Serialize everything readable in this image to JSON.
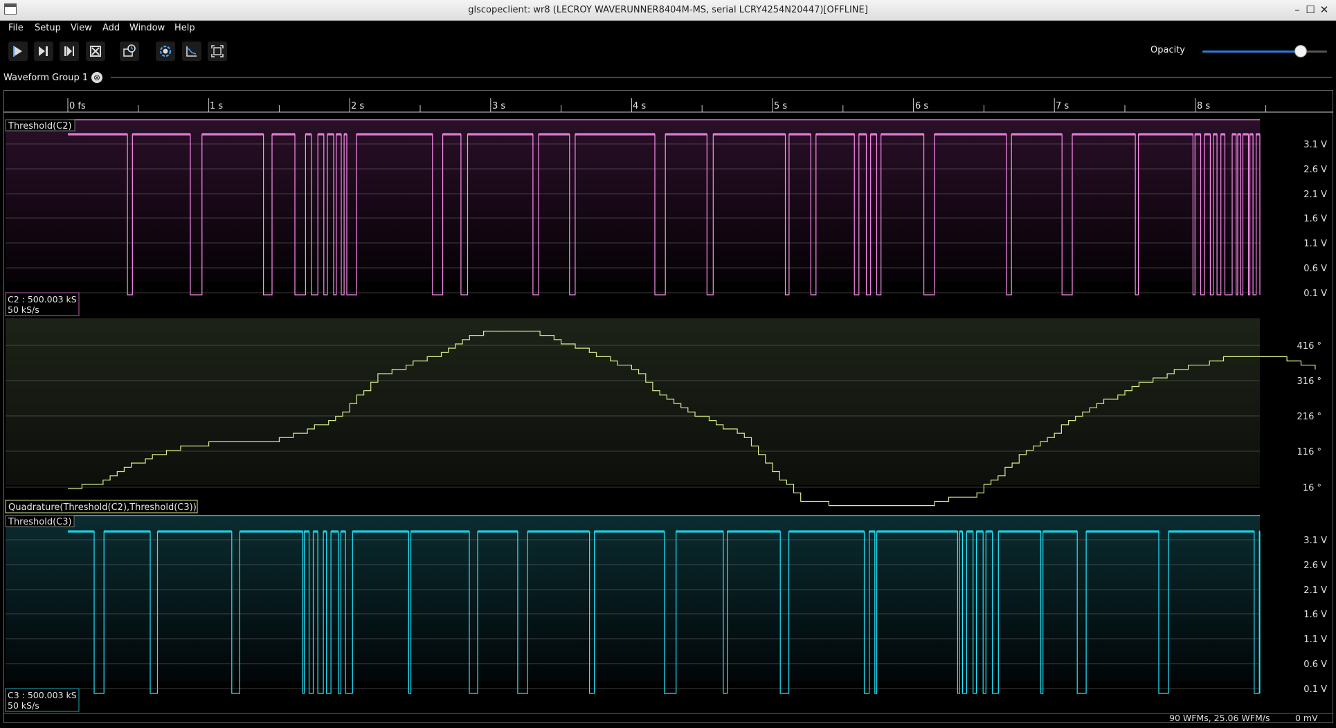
{
  "window": {
    "title": "glscopeclient: wr8 (LECROY WAVERUNNER8404M-MS, serial LCRY4254N20447)[OFFLINE]",
    "buttons": [
      "–",
      "☐",
      "✕"
    ]
  },
  "menu": [
    "File",
    "Setup",
    "View",
    "Add",
    "Window",
    "Help"
  ],
  "toolbar": {
    "buttons": [
      "start-trigger",
      "single-trigger",
      "force-trigger",
      "stop-trigger",
      "history",
      "refresh-settings",
      "graph-editor",
      "fullscreen"
    ],
    "opacity_label": "Opacity",
    "opacity_value": 0.82
  },
  "tab": {
    "label": "Waveform Group 1",
    "close": "⊗"
  },
  "timeline": {
    "ticks": [
      "0 fs",
      "1 s",
      "2 s",
      "3 s",
      "4 s",
      "5 s",
      "6 s",
      "7 s",
      "8 s"
    ]
  },
  "colors": {
    "c2": "#ff8ff0",
    "math": "#d6f08a",
    "c3": "#22e8ff",
    "grid": "#6a6a6a",
    "axis_text": "#e0e0e0"
  },
  "panels": {
    "c2": {
      "title": "Threshold(C2)",
      "info_line1": "C2 : 500.003 kS",
      "info_line2": "50 kS/s",
      "yticks": [
        "3.1 V",
        "2.6 V",
        "2.1 V",
        "1.6 V",
        "1.1 V",
        "0.6 V",
        "0.1 V"
      ]
    },
    "quad": {
      "title": "Quadrature(Threshold(C2),Threshold(C3))",
      "yticks": [
        "416 °",
        "316 °",
        "216 °",
        "116 °",
        "16 °"
      ]
    },
    "c3": {
      "title": "Threshold(C3)",
      "info_line1": "C3 : 500.003 kS",
      "info_line2": "50 kS/s",
      "yticks": [
        "3.1 V",
        "2.6 V",
        "2.1 V",
        "1.6 V",
        "1.1 V",
        "0.6 V",
        "0.1 V"
      ]
    }
  },
  "status": {
    "rate": "90 WFMs, 25.06 WFM/s",
    "value": "0 mV"
  }
}
